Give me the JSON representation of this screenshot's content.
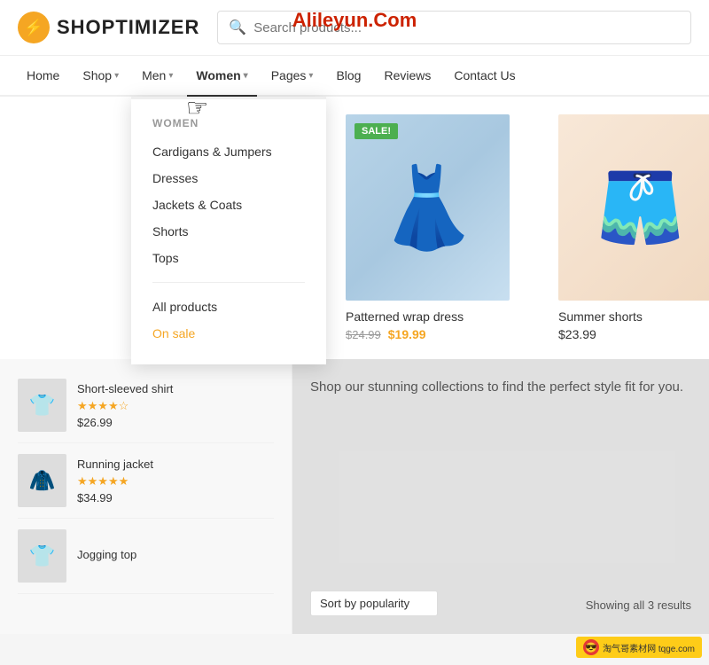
{
  "watermark": "Alileyun.Com",
  "header": {
    "logo_text": "SHOPTIMIZER",
    "search_placeholder": "Search products..."
  },
  "nav": {
    "items": [
      {
        "label": "Home",
        "has_chevron": false,
        "active": false
      },
      {
        "label": "Shop",
        "has_chevron": true,
        "active": false
      },
      {
        "label": "Men",
        "has_chevron": true,
        "active": false
      },
      {
        "label": "Women",
        "has_chevron": true,
        "active": true
      },
      {
        "label": "Pages",
        "has_chevron": true,
        "active": false
      },
      {
        "label": "Blog",
        "has_chevron": false,
        "active": false
      },
      {
        "label": "Reviews",
        "has_chevron": false,
        "active": false
      },
      {
        "label": "Contact Us",
        "has_chevron": false,
        "active": false
      }
    ]
  },
  "dropdown": {
    "section_title": "WOMEN",
    "items": [
      {
        "label": "Cardigans & Jumpers",
        "type": "regular"
      },
      {
        "label": "Dresses",
        "type": "regular"
      },
      {
        "label": "Jackets & Coats",
        "type": "regular"
      },
      {
        "label": "Shorts",
        "type": "regular"
      },
      {
        "label": "Tops",
        "type": "regular"
      },
      {
        "label": "All products",
        "type": "regular"
      },
      {
        "label": "On sale",
        "type": "sale"
      }
    ]
  },
  "products": [
    {
      "title": "Patterned wrap dress",
      "price_old": "$24.99",
      "price_new": "$19.99",
      "on_sale": true,
      "sale_label": "SALE!"
    },
    {
      "title": "Summer shorts",
      "price_regular": "$23.99",
      "on_sale": false
    }
  ],
  "list_products": [
    {
      "name": "Short-sleeved shirt",
      "stars": "★★★★☆",
      "price": "$26.99",
      "icon": "👕"
    },
    {
      "name": "Running jacket",
      "stars": "★★★★★",
      "price": "$34.99",
      "icon": "🧥"
    },
    {
      "name": "Jogging top",
      "stars": "",
      "price": "",
      "icon": "👕"
    }
  ],
  "right_text": "Shop our stunning collections to find the perfect style fit for you.",
  "sort": {
    "label": "Sort by popularity",
    "showing": "Showing all 3 results"
  },
  "brand_badge": "淘气哥素材网 tqge.com"
}
